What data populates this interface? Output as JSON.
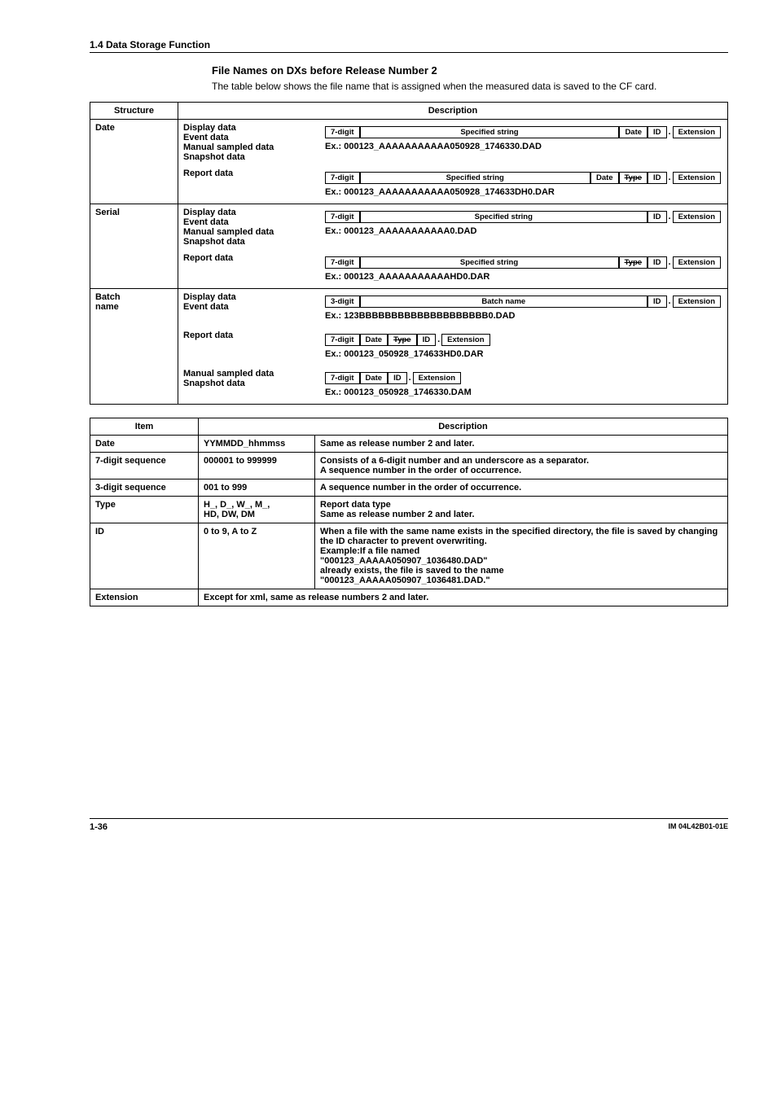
{
  "section_header": "1.4  Data Storage Function",
  "subhead": "File Names on DXs before Release Number 2",
  "intro": "The table below shows the file name that is assigned when the measured data is saved to the CF card.",
  "t1": {
    "head": {
      "structure": "Structure",
      "description": "Description"
    },
    "rows": [
      {
        "label": "Date",
        "groups": [
          {
            "types": "Display data\nEvent data\nManual sampled data\nSnapshot data",
            "tags": [
              "7-digit",
              "Specified string",
              "Date",
              "ID",
              ".",
              "Extension"
            ],
            "stretch_idx": 1,
            "example": "Ex.: 000123_AAAAAAAAAAA050928_1746330.DAD"
          },
          {
            "types": "Report data",
            "tags": [
              "7-digit",
              "Specified string",
              "Date",
              "Type",
              "ID",
              ".",
              "Extension"
            ],
            "stretch_idx": 1,
            "strike_idx": 3,
            "example": "Ex.: 000123_AAAAAAAAAAA050928_174633DH0.DAR"
          }
        ]
      },
      {
        "label": "Serial",
        "groups": [
          {
            "types": "Display data\nEvent data\nManual sampled data\nSnapshot data",
            "tags": [
              "7-digit",
              "Specified string",
              "ID",
              ".",
              "Extension"
            ],
            "stretch_idx": 1,
            "example": "Ex.: 000123_AAAAAAAAAAA0.DAD"
          },
          {
            "types": "Report data",
            "tags": [
              "7-digit",
              "Specified string",
              "Type",
              "ID",
              ".",
              "Extension"
            ],
            "stretch_idx": 1,
            "strike_idx": 2,
            "example": "Ex.: 000123_AAAAAAAAAAAHD0.DAR"
          }
        ]
      },
      {
        "label": "Batch\nname",
        "groups": [
          {
            "types": "Display data\nEvent data",
            "tags": [
              "3-digit",
              "Batch name",
              "ID",
              ".",
              "Extension"
            ],
            "stretch_idx": 1,
            "example": "Ex.: 123BBBBBBBBBBBBBBBBBBBB0.DAD"
          },
          {
            "types": "Report data",
            "tags": [
              "7-digit",
              "Date",
              "Type",
              "ID",
              ".",
              "Extension"
            ],
            "strike_idx": 2,
            "example": "Ex.: 000123_050928_174633HD0.DAR"
          },
          {
            "types": "Manual sampled data\nSnapshot data",
            "tags": [
              "7-digit",
              "Date",
              "ID",
              ".",
              "Extension"
            ],
            "example": "Ex.: 000123_050928_1746330.DAM"
          }
        ]
      }
    ]
  },
  "t2": {
    "head": {
      "item": "Item",
      "description": "Description"
    },
    "rows": [
      {
        "item": "Date",
        "val": "YYMMDD_hhmmss",
        "desc": "Same as release number 2 and later."
      },
      {
        "item": "7-digit sequence",
        "val": "000001 to 999999",
        "desc": "Consists of a 6-digit number and an underscore as a separator.\nA sequence number in the order of occurrence."
      },
      {
        "item": "3-digit sequence",
        "val": "001 to 999",
        "desc": "A sequence number in the order of occurrence."
      },
      {
        "item": "Type",
        "val": "H_, D_, W_, M_,\nHD, DW, DM",
        "desc": "Report data type\nSame as release number 2 and later."
      },
      {
        "item": "ID",
        "val": "0 to 9, A to Z",
        "desc": "When a file with the same name exists in the specified directory, the file is saved by changing the ID character to prevent overwriting.\nExample:If a file named\n\"000123_AAAAA050907_1036480.DAD\"\nalready exists, the file is saved to the name\n\"000123_AAAAA050907_1036481.DAD.\""
      },
      {
        "item": "Extension",
        "span": true,
        "desc": "Except for xml, same as release numbers 2 and later."
      }
    ]
  },
  "footer": {
    "page": "1-36",
    "doc": "IM 04L42B01-01E"
  }
}
